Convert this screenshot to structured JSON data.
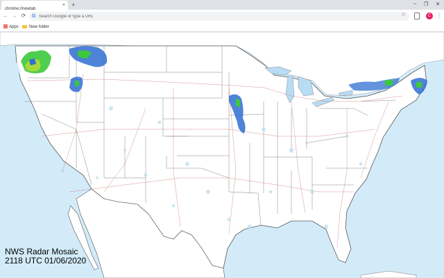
{
  "tab": {
    "title": "chrome://newtab",
    "close_icon": "×",
    "new_tab_icon": "+"
  },
  "window_controls": {
    "minimize": "−",
    "maximize": "❐",
    "close": "✕"
  },
  "toolbar": {
    "back_icon": "←",
    "forward_icon": "→",
    "reload_icon": "⟳",
    "search_placeholder": "Search Google or type a URL",
    "bookmark_star_icon": "☆",
    "profile_initial": "C",
    "menu_icon": "⋮"
  },
  "bookmarks": {
    "apps_label": "Apps",
    "folder_label": "New folder"
  },
  "map": {
    "title": "NWS Radar Mosaic",
    "timestamp": "2118 UTC 01/06/2020",
    "colors": {
      "water": "#d3ebf9",
      "land": "#ffffff",
      "border": "#666666",
      "roads": "#c86464",
      "radar_green": "#3cc83c",
      "radar_blue": "#2f6fd1"
    }
  }
}
